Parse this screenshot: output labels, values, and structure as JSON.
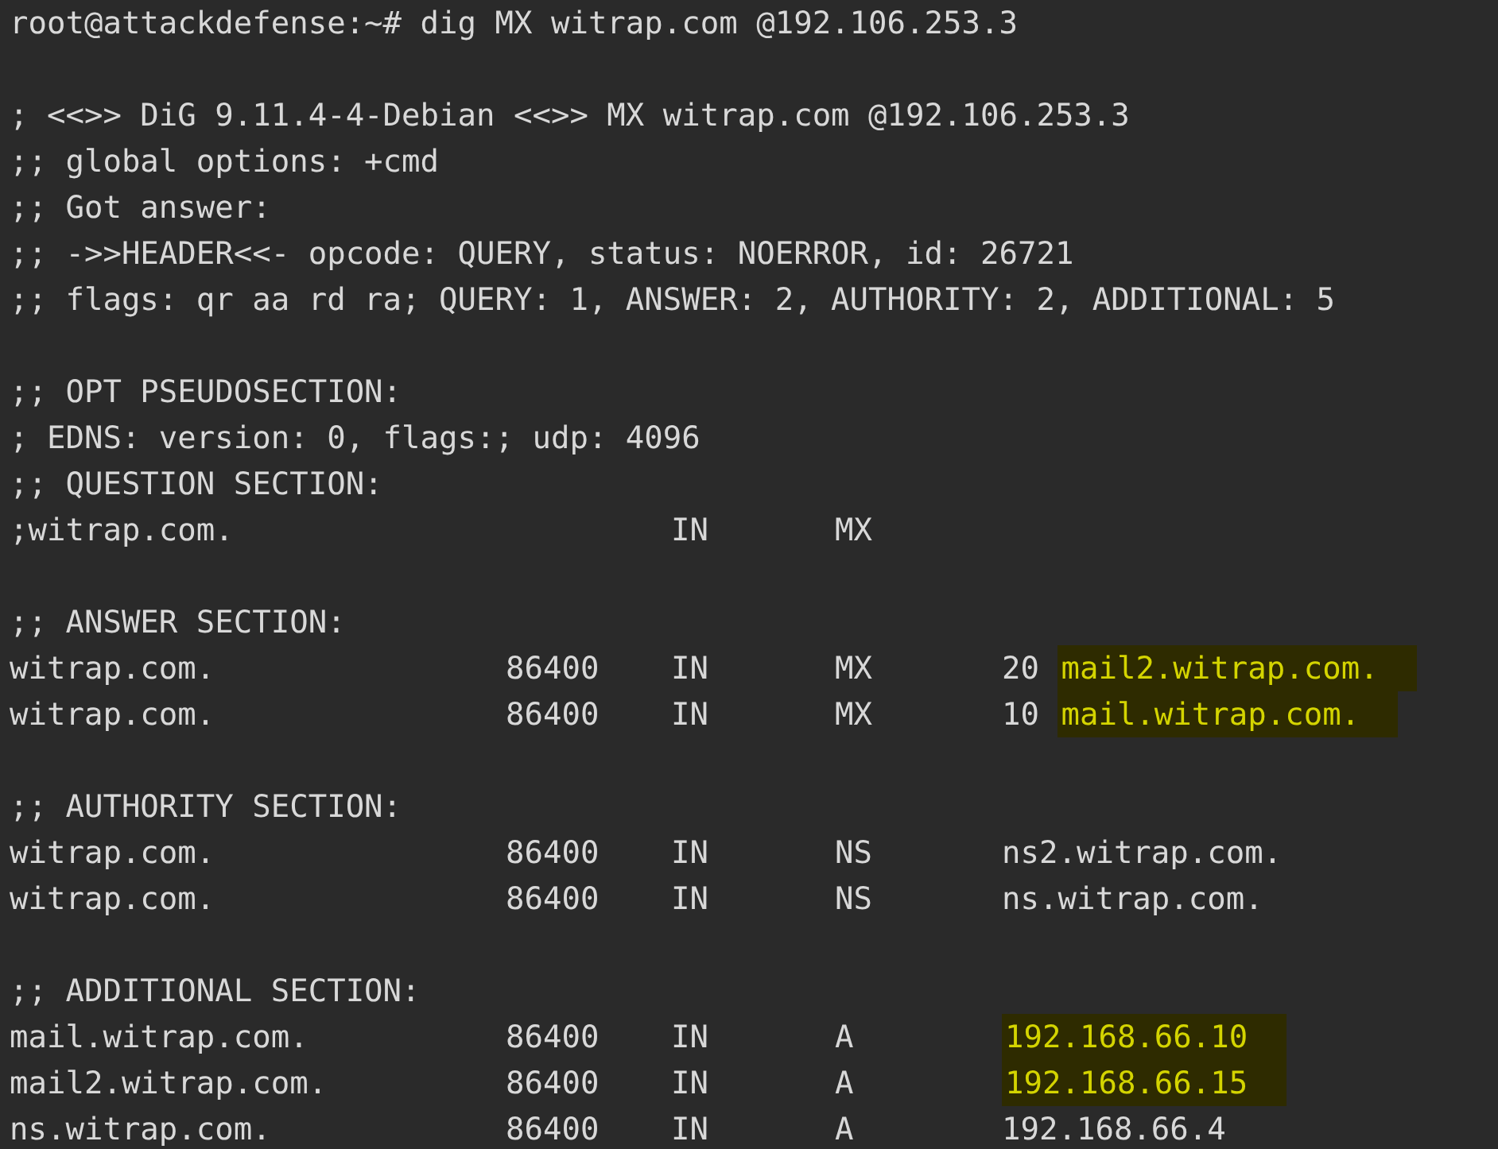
{
  "terminal": {
    "lines": [
      {
        "kind": "text",
        "text": "root@attackdefense:~# dig MX witrap.com @192.106.253.3"
      },
      {
        "kind": "blank"
      },
      {
        "kind": "text",
        "text": "; <<>> DiG 9.11.4-4-Debian <<>> MX witrap.com @192.106.253.3"
      },
      {
        "kind": "text",
        "text": ";; global options: +cmd"
      },
      {
        "kind": "text",
        "text": ";; Got answer:"
      },
      {
        "kind": "text",
        "text": ";; ->>HEADER<<- opcode: QUERY, status: NOERROR, id: 26721"
      },
      {
        "kind": "text",
        "text": ";; flags: qr aa rd ra; QUERY: 1, ANSWER: 2, AUTHORITY: 2, ADDITIONAL: 5"
      },
      {
        "kind": "blank"
      },
      {
        "kind": "text",
        "text": ";; OPT PSEUDOSECTION:"
      },
      {
        "kind": "text",
        "text": "; EDNS: version: 0, flags:; udp: 4096"
      },
      {
        "kind": "text",
        "text": ";; QUESTION SECTION:"
      },
      {
        "kind": "record",
        "name": ";witrap.com.",
        "class": "IN",
        "type": "MX"
      },
      {
        "kind": "blank"
      },
      {
        "kind": "text",
        "text": ";; ANSWER SECTION:"
      },
      {
        "kind": "record",
        "name": "witrap.com.",
        "ttl": "86400",
        "class": "IN",
        "type": "MX",
        "preference": "20",
        "data": "mail2.witrap.com.",
        "highlighted": true
      },
      {
        "kind": "record",
        "name": "witrap.com.",
        "ttl": "86400",
        "class": "IN",
        "type": "MX",
        "preference": "10",
        "data": "mail.witrap.com.",
        "highlighted": true
      },
      {
        "kind": "blank"
      },
      {
        "kind": "text",
        "text": ";; AUTHORITY SECTION:"
      },
      {
        "kind": "record",
        "name": "witrap.com.",
        "ttl": "86400",
        "class": "IN",
        "type": "NS",
        "data": "ns2.witrap.com.",
        "highlighted": false
      },
      {
        "kind": "record",
        "name": "witrap.com.",
        "ttl": "86400",
        "class": "IN",
        "type": "NS",
        "data": "ns.witrap.com.",
        "highlighted": false
      },
      {
        "kind": "blank"
      },
      {
        "kind": "text",
        "text": ";; ADDITIONAL SECTION:"
      },
      {
        "kind": "record",
        "name": "mail.witrap.com.",
        "ttl": "86400",
        "class": "IN",
        "type": "A",
        "data": "192.168.66.10",
        "highlighted": true
      },
      {
        "kind": "record",
        "name": "mail2.witrap.com.",
        "ttl": "86400",
        "class": "IN",
        "type": "A",
        "data": "192.168.66.15",
        "highlighted": true
      },
      {
        "kind": "record",
        "name": "ns.witrap.com.",
        "ttl": "86400",
        "class": "IN",
        "type": "A",
        "data": "192.168.66.4",
        "highlighted": false
      }
    ]
  }
}
